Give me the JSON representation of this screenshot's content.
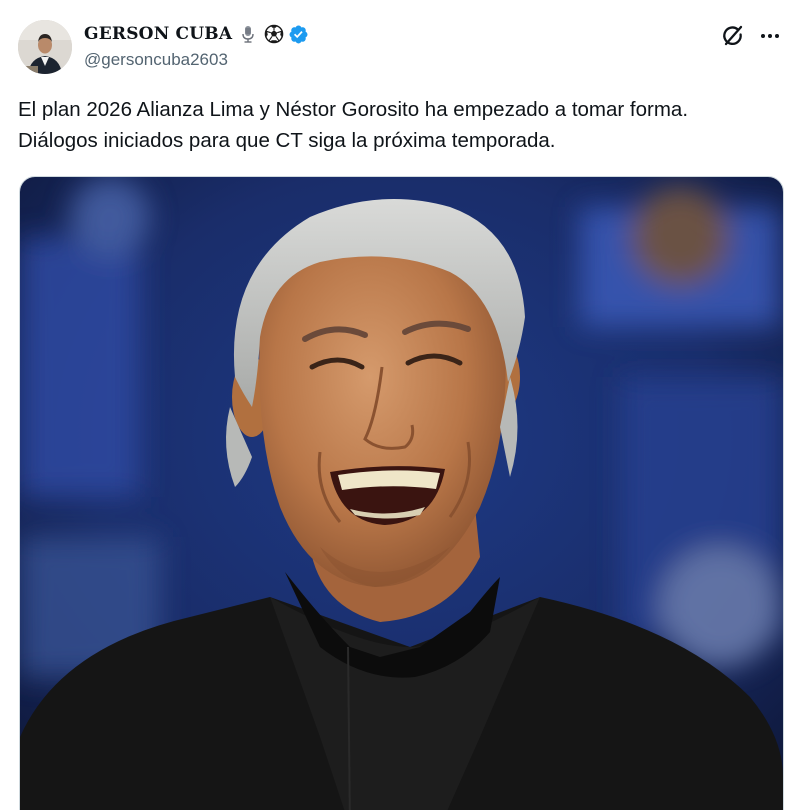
{
  "author": {
    "display_name": "GERSON CUBA",
    "name_emojis": [
      "microphone-icon",
      "soccer-ball-icon"
    ],
    "verified": true,
    "handle": "@gersoncuba2603"
  },
  "post": {
    "text_lines": [
      "El plan 2026 Alianza Lima y Néstor Gorosito ha empezado a tomar forma.",
      "Diálogos iniciados para que CT siga la próxima temporada."
    ]
  },
  "icons": {
    "grok": "grok-icon",
    "more": "more-icon"
  },
  "colors": {
    "text": "#0f1419",
    "secondary": "#536471",
    "verified": "#1d9bf0",
    "border": "#cfd9de"
  }
}
